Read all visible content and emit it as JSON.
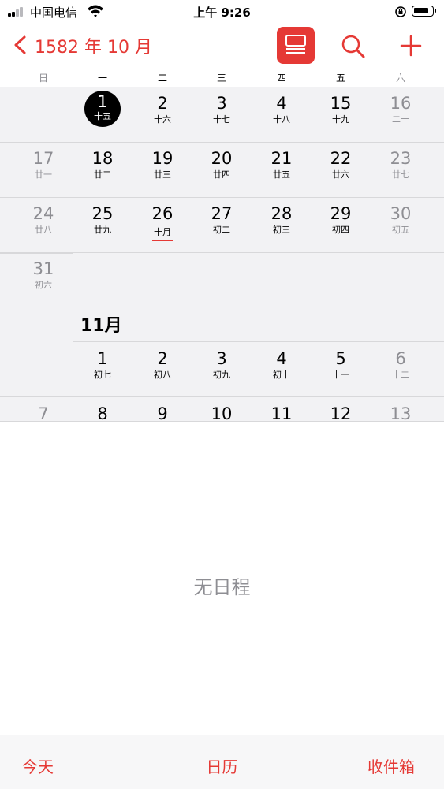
{
  "status_bar": {
    "carrier": "中国电信",
    "time": "上午 9:26",
    "icons": [
      "signal-icon",
      "wifi-icon",
      "rotation-lock-icon",
      "battery-icon"
    ]
  },
  "nav": {
    "back_icon": "chevron-left-icon",
    "title": "1582 年 10 月",
    "list_icon": "list-view-icon",
    "search_icon": "search-icon",
    "add_icon": "plus-icon",
    "accent_color": "#e53935"
  },
  "weekdays": [
    "日",
    "一",
    "二",
    "三",
    "四",
    "五",
    "六"
  ],
  "october": {
    "weeks": [
      [
        {
          "num": "",
          "lunar": ""
        },
        {
          "num": "1",
          "lunar": "十五",
          "today": true
        },
        {
          "num": "2",
          "lunar": "十六"
        },
        {
          "num": "3",
          "lunar": "十七"
        },
        {
          "num": "4",
          "lunar": "十八"
        },
        {
          "num": "15",
          "lunar": "十九"
        },
        {
          "num": "16",
          "lunar": "二十"
        }
      ],
      [
        {
          "num": "17",
          "lunar": "廿一"
        },
        {
          "num": "18",
          "lunar": "廿二"
        },
        {
          "num": "19",
          "lunar": "廿三"
        },
        {
          "num": "20",
          "lunar": "廿四"
        },
        {
          "num": "21",
          "lunar": "廿五"
        },
        {
          "num": "22",
          "lunar": "廿六"
        },
        {
          "num": "23",
          "lunar": "廿七"
        }
      ],
      [
        {
          "num": "24",
          "lunar": "廿八"
        },
        {
          "num": "25",
          "lunar": "廿九"
        },
        {
          "num": "26",
          "lunar": "十月",
          "marked": true
        },
        {
          "num": "27",
          "lunar": "初二"
        },
        {
          "num": "28",
          "lunar": "初三"
        },
        {
          "num": "29",
          "lunar": "初四"
        },
        {
          "num": "30",
          "lunar": "初五"
        }
      ],
      [
        {
          "num": "31",
          "lunar": "初六"
        }
      ]
    ]
  },
  "november": {
    "label": "11月",
    "weeks": [
      [
        {
          "num": "",
          "lunar": ""
        },
        {
          "num": "1",
          "lunar": "初七"
        },
        {
          "num": "2",
          "lunar": "初八"
        },
        {
          "num": "3",
          "lunar": "初九"
        },
        {
          "num": "4",
          "lunar": "初十"
        },
        {
          "num": "5",
          "lunar": "十一"
        },
        {
          "num": "6",
          "lunar": "十二"
        }
      ],
      [
        {
          "num": "7",
          "lunar": ""
        },
        {
          "num": "8",
          "lunar": ""
        },
        {
          "num": "9",
          "lunar": ""
        },
        {
          "num": "10",
          "lunar": ""
        },
        {
          "num": "11",
          "lunar": ""
        },
        {
          "num": "12",
          "lunar": ""
        },
        {
          "num": "13",
          "lunar": ""
        }
      ]
    ]
  },
  "events": {
    "empty_text": "无日程"
  },
  "tabbar": {
    "today": "今天",
    "calendars": "日历",
    "inbox": "收件箱"
  }
}
